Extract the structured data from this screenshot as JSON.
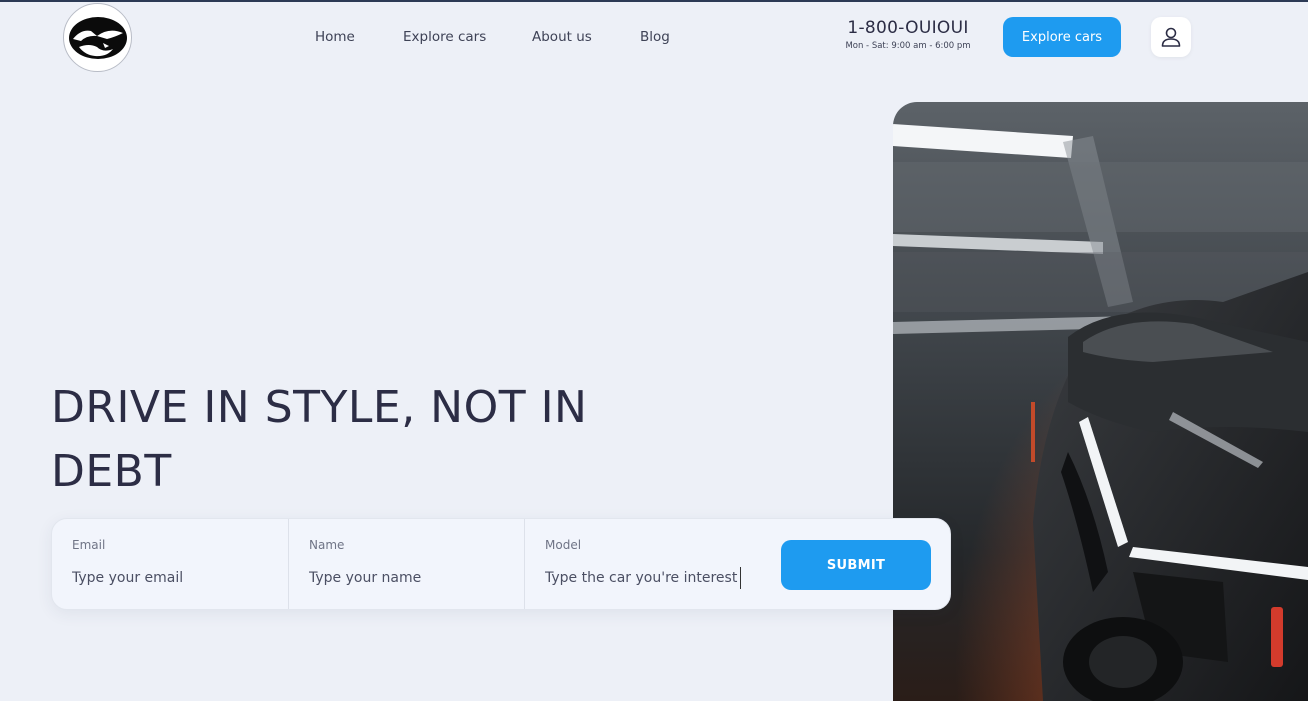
{
  "header": {
    "nav": [
      {
        "label": "Home"
      },
      {
        "label": "Explore cars"
      },
      {
        "label": "About us"
      },
      {
        "label": "Blog"
      }
    ],
    "phone": "1-800-OUIOUI",
    "hours": "Mon - Sat: 9:00 am - 6:00 pm",
    "cta_label": "Explore cars"
  },
  "hero": {
    "title": "DRIVE IN STYLE, NOT IN DEBT"
  },
  "form": {
    "email": {
      "label": "Email",
      "placeholder": "Type your email"
    },
    "name": {
      "label": "Name",
      "placeholder": "Type your name"
    },
    "model": {
      "label": "Model",
      "placeholder": "Type the car you're interest"
    },
    "submit_label": "SUBMIT"
  },
  "colors": {
    "accent": "#1e9bf0",
    "background": "#edf0f7",
    "text": "#2c2d45"
  }
}
